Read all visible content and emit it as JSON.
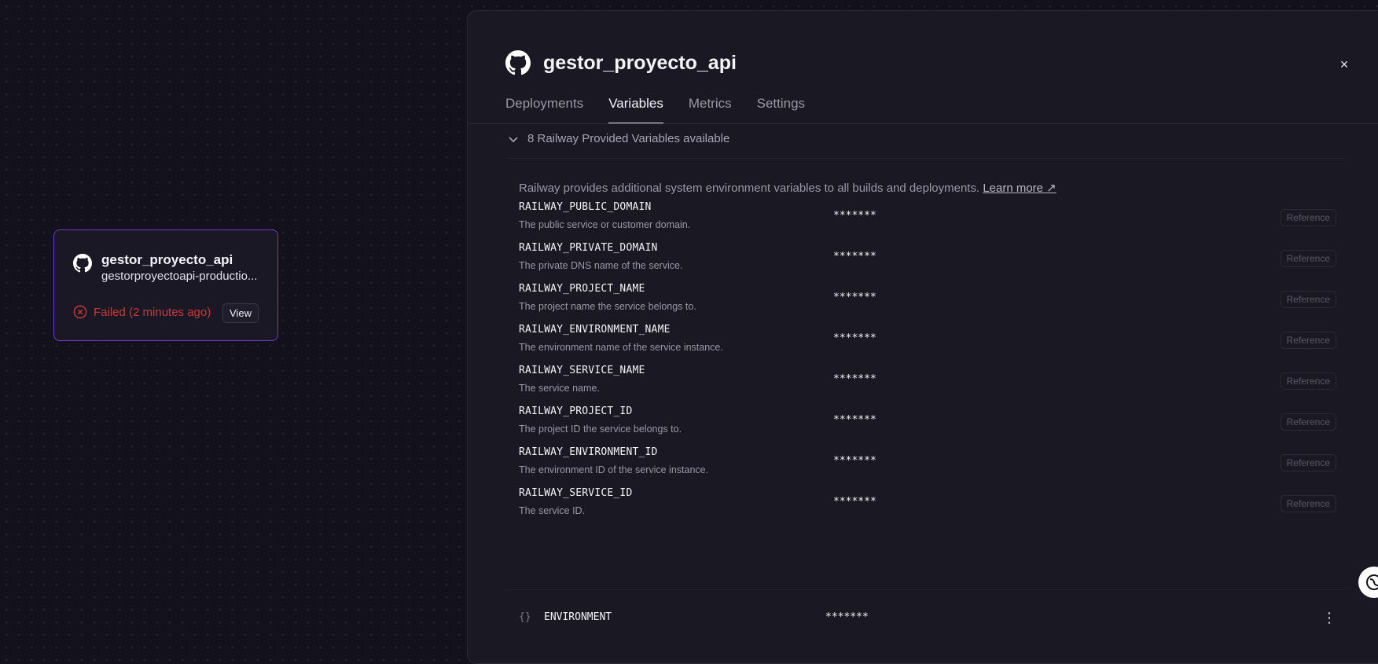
{
  "canvas": {
    "card": {
      "title": "gestor_proyecto_api",
      "url": "gestorproyectoapi-productio...",
      "status": "Failed (2 minutes ago)",
      "view_label": "View",
      "icon": "github-icon"
    }
  },
  "panel": {
    "title": "gestor_proyecto_api",
    "close_label": "×",
    "tabs": [
      {
        "label": "Deployments"
      },
      {
        "label": "Variables"
      },
      {
        "label": "Metrics"
      },
      {
        "label": "Settings"
      }
    ],
    "active_tab": "Variables",
    "provided_toggle": "8 Railway Provided Variables available",
    "info_text": "Railway provides additional system environment variables to all builds and deployments.",
    "learn_more": "Learn more ↗",
    "reference_label": "Reference",
    "variables": [
      {
        "name": "RAILWAY_PUBLIC_DOMAIN",
        "desc": "The public service or customer domain.",
        "value": "*******"
      },
      {
        "name": "RAILWAY_PRIVATE_DOMAIN",
        "desc": "The private DNS name of the service.",
        "value": "*******"
      },
      {
        "name": "RAILWAY_PROJECT_NAME",
        "desc": "The project name the service belongs to.",
        "value": "*******"
      },
      {
        "name": "RAILWAY_ENVIRONMENT_NAME",
        "desc": "The environment name of the service instance.",
        "value": "*******"
      },
      {
        "name": "RAILWAY_SERVICE_NAME",
        "desc": "The service name.",
        "value": "*******"
      },
      {
        "name": "RAILWAY_PROJECT_ID",
        "desc": "The project ID the service belongs to.",
        "value": "*******"
      },
      {
        "name": "RAILWAY_ENVIRONMENT_ID",
        "desc": "The environment ID of the service instance.",
        "value": "*******"
      },
      {
        "name": "RAILWAY_SERVICE_ID",
        "desc": "The service ID.",
        "value": "*******"
      }
    ],
    "user_variable": {
      "braces": "{}",
      "name": "ENVIRONMENT",
      "value": "*******",
      "menu": "⋮"
    }
  },
  "colors": {
    "background": "#13111c",
    "panel": "#1a1823",
    "accent_border": "#6d3fc0",
    "error": "#c53a3a"
  }
}
